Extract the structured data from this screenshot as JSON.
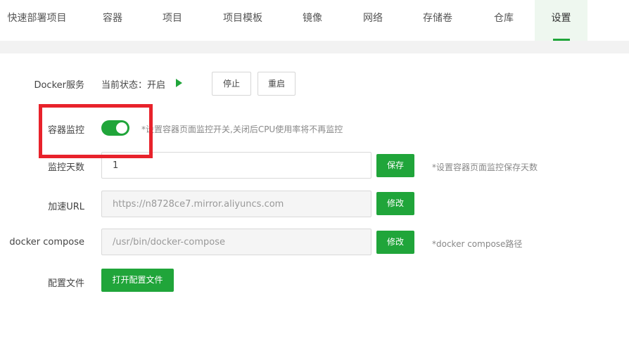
{
  "tabs": [
    {
      "label": "快速部署项目"
    },
    {
      "label": "容器"
    },
    {
      "label": "项目"
    },
    {
      "label": "项目模板"
    },
    {
      "label": "镜像"
    },
    {
      "label": "网络"
    },
    {
      "label": "存储卷"
    },
    {
      "label": "仓库"
    },
    {
      "label": "设置",
      "active": true
    }
  ],
  "settings": {
    "docker_service": {
      "label": "Docker服务",
      "status": "当前状态：开启",
      "stop_label": "停止",
      "restart_label": "重启"
    },
    "monitor": {
      "label": "容器监控",
      "enabled": true,
      "hint": "*设置容器页面监控开关,关闭后CPU使用率将不再监控"
    },
    "monitor_days": {
      "label": "监控天数",
      "value": "1",
      "save_label": "保存",
      "hint": "*设置容器页面监控保存天数"
    },
    "accel_url": {
      "label": "加速URL",
      "value": "https://n8728ce7.mirror.aliyuncs.com",
      "edit_label": "修改"
    },
    "compose": {
      "label": "docker compose",
      "value": "/usr/bin/docker-compose",
      "edit_label": "修改",
      "hint": "*docker compose路径"
    },
    "config_file": {
      "label": "配置文件",
      "open_label": "打开配置文件"
    }
  },
  "colors": {
    "accent": "#20a53a",
    "highlight": "#e8222b"
  }
}
